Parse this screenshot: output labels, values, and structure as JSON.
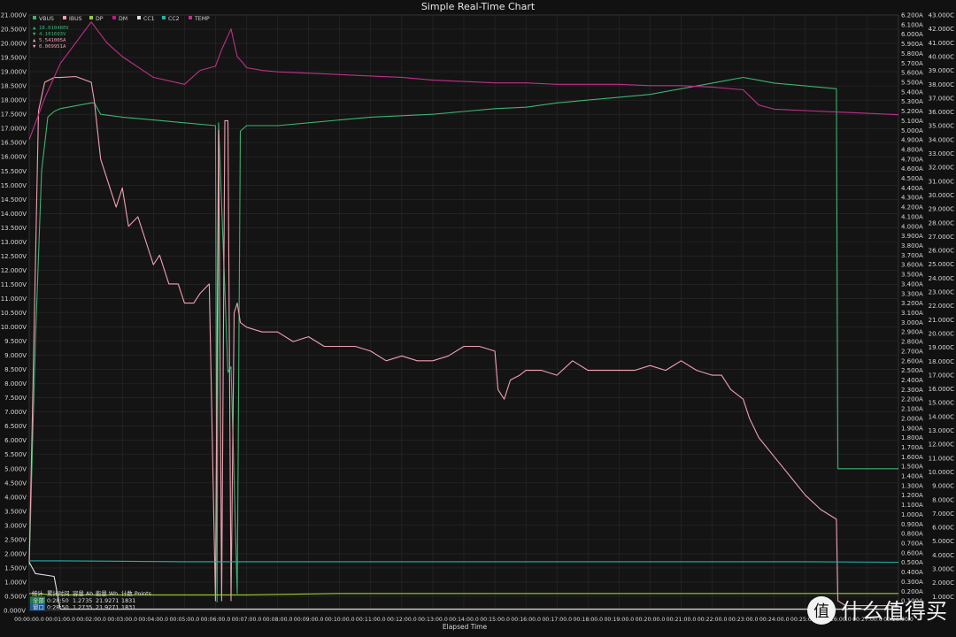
{
  "chart_data": {
    "type": "line",
    "title": "Simple Real-Time Chart",
    "xlabel": "Elapsed Time",
    "x_ticks": [
      "00:00:00.0",
      "00:01:00.0",
      "00:02:00.0",
      "00:03:00.0",
      "00:04:00.0",
      "00:05:00.0",
      "00:06:00.0",
      "00:07:00.0",
      "00:08:00.0",
      "00:09:00.0",
      "00:10:00.0",
      "00:11:00.0",
      "00:12:00.0",
      "00:13:00.0",
      "00:14:00.0",
      "00:15:00.0",
      "00:16:00.0",
      "00:17:00.0",
      "00:18:00.0",
      "00:19:00.0",
      "00:20:00.0",
      "00:21:00.0",
      "00:22:00.0",
      "00:23:00.0",
      "00:24:00.0",
      "00:25:00.0",
      "00:26:00.0",
      "00:27:00.0",
      "00:28:00.0"
    ],
    "x_range_min": [
      0,
      28
    ],
    "y_left": {
      "unit": "V",
      "range": [
        0,
        21
      ],
      "ticks": [
        "0.500V",
        "1.000V",
        "1.500V",
        "2.000V",
        "2.500V",
        "3.000V",
        "3.500V",
        "4.000V",
        "4.500V",
        "5.000V",
        "5.500V",
        "6.000V",
        "6.500V",
        "7.000V",
        "7.500V",
        "8.000V",
        "8.500V",
        "9.000V",
        "9.500V",
        "10.000V",
        "10.500V",
        "11.000V",
        "11.500V",
        "12.000V",
        "12.500V",
        "13.000V",
        "13.500V",
        "14.000V",
        "14.500V",
        "15.000V",
        "15.500V",
        "16.000V",
        "16.500V",
        "17.000V",
        "17.500V",
        "18.000V",
        "18.500V",
        "19.000V",
        "19.500V",
        "20.000V",
        "20.500V",
        "21.000V"
      ]
    },
    "y_right_current": {
      "unit": "A",
      "range": [
        0,
        6.2
      ],
      "ticks": [
        "0.100A",
        "0.200A",
        "0.300A",
        "0.400A",
        "0.500A",
        "0.600A",
        "0.700A",
        "0.800A",
        "0.900A",
        "1.000A",
        "1.100A",
        "1.200A",
        "1.300A",
        "1.400A",
        "1.500A",
        "1.600A",
        "1.700A",
        "1.800A",
        "1.900A",
        "2.000A",
        "2.100A",
        "2.200A",
        "2.300A",
        "2.400A",
        "2.500A",
        "2.600A",
        "2.700A",
        "2.800A",
        "2.900A",
        "3.000A",
        "3.100A",
        "3.200A",
        "3.300A",
        "3.400A",
        "3.500A",
        "3.600A",
        "3.700A",
        "3.800A",
        "3.900A",
        "4.000A",
        "4.100A",
        "4.200A",
        "4.300A",
        "4.400A",
        "4.500A",
        "4.600A",
        "4.700A",
        "4.800A",
        "4.900A",
        "5.000A",
        "5.100A",
        "5.200A",
        "5.300A",
        "5.400A",
        "5.500A",
        "5.600A",
        "5.700A",
        "5.800A",
        "5.900A",
        "6.000A",
        "6.100A",
        "6.200A"
      ]
    },
    "y_right_temp": {
      "unit": "C",
      "range": [
        0,
        43
      ],
      "ticks": [
        "1.000C",
        "2.000C",
        "3.000C",
        "4.000C",
        "5.000C",
        "6.000C",
        "7.000C",
        "8.000C",
        "9.000C",
        "10.000C",
        "11.000C",
        "12.000C",
        "13.000C",
        "14.000C",
        "15.000C",
        "16.000C",
        "17.000C",
        "18.000C",
        "19.000C",
        "20.000C",
        "21.000C",
        "22.000C",
        "23.000C",
        "24.000C",
        "25.000C",
        "26.000C",
        "27.000C",
        "28.000C",
        "29.000C",
        "30.000C",
        "31.000C",
        "32.000C",
        "33.000C",
        "34.000C",
        "35.000C",
        "36.000C",
        "37.000C",
        "38.000C",
        "39.000C",
        "40.000C",
        "41.000C",
        "42.000C",
        "43.000C"
      ]
    },
    "legend": [
      {
        "name": "VBUS",
        "color": "#3cb371"
      },
      {
        "name": "IBUS",
        "color": "#f0a0b0"
      },
      {
        "name": "DP",
        "color": "#9acd32"
      },
      {
        "name": "DM",
        "color": "#c71585"
      },
      {
        "name": "CC1",
        "color": "#e0e0e0"
      },
      {
        "name": "CC2",
        "color": "#20b2aa"
      },
      {
        "name": "TEMP",
        "color": "#c0308a"
      }
    ],
    "legend_placement": "top-left",
    "readouts": [
      {
        "text": "18.010480V",
        "color": "#3cb371"
      },
      {
        "text": "4.101693V",
        "color": "#3cb371"
      },
      {
        "text": "5.541005A",
        "color": "#f0a0b0"
      },
      {
        "text": "0.009951A",
        "color": "#f0a0b0"
      }
    ],
    "series": [
      {
        "name": "VBUS",
        "axis": "V",
        "color": "#3cb371",
        "x": [
          0,
          0.2,
          0.4,
          0.6,
          0.8,
          1,
          1.5,
          2,
          2.1,
          2.3,
          3,
          4,
          5,
          6,
          6.05,
          6.1,
          6.4,
          6.5,
          6.7,
          6.8,
          7,
          8,
          9,
          10,
          11,
          12,
          13,
          14,
          15,
          16,
          17,
          18,
          19,
          20,
          21,
          22,
          22.5,
          23,
          23.5,
          24,
          25,
          26,
          26.05,
          27,
          28
        ],
        "y": [
          1.6,
          9.5,
          15.5,
          17.4,
          17.6,
          17.7,
          17.8,
          17.9,
          17.9,
          17.5,
          17.4,
          17.3,
          17.2,
          17.1,
          0.3,
          17.2,
          8.4,
          8.6,
          0.6,
          16.9,
          17.1,
          17.1,
          17.2,
          17.3,
          17.4,
          17.45,
          17.5,
          17.6,
          17.7,
          17.75,
          17.9,
          18.0,
          18.1,
          18.2,
          18.4,
          18.6,
          18.7,
          18.8,
          18.7,
          18.6,
          18.5,
          18.4,
          5.0,
          5.0,
          5.0
        ]
      },
      {
        "name": "IBUS",
        "axis": "A",
        "color": "#f0a0b0",
        "x": [
          0,
          0.1,
          0.3,
          0.5,
          0.8,
          1,
          1.5,
          2,
          2.1,
          2.3,
          2.6,
          2.8,
          3,
          3.2,
          3.5,
          3.8,
          4,
          4.2,
          4.5,
          4.8,
          5,
          5.3,
          5.5,
          5.8,
          6,
          6.1,
          6.2,
          6.3,
          6.4,
          6.5,
          6.6,
          6.7,
          6.8,
          7,
          7.5,
          8,
          8.5,
          9,
          9.5,
          10,
          10.5,
          11,
          11.5,
          12,
          12.5,
          13,
          13.5,
          14,
          14.5,
          15,
          15.1,
          15.3,
          15.5,
          15.8,
          16,
          16.5,
          17,
          17.5,
          18,
          18.5,
          19,
          19.5,
          20,
          20.5,
          21,
          21.5,
          22,
          22.3,
          22.6,
          23,
          23.2,
          23.5,
          24,
          24.5,
          25,
          25.5,
          26,
          26.05,
          26.3,
          27,
          28
        ],
        "y": [
          0.5,
          2.0,
          5.2,
          5.5,
          5.55,
          5.55,
          5.56,
          5.5,
          5.3,
          4.7,
          4.4,
          4.2,
          4.4,
          4.0,
          4.1,
          3.8,
          3.6,
          3.7,
          3.4,
          3.4,
          3.2,
          3.2,
          3.3,
          3.4,
          0.1,
          5.0,
          0.1,
          5.1,
          5.1,
          0.1,
          3.1,
          3.2,
          3.0,
          2.95,
          2.9,
          2.9,
          2.8,
          2.85,
          2.75,
          2.75,
          2.75,
          2.7,
          2.6,
          2.65,
          2.6,
          2.6,
          2.65,
          2.75,
          2.75,
          2.7,
          2.3,
          2.2,
          2.4,
          2.45,
          2.5,
          2.5,
          2.45,
          2.6,
          2.5,
          2.5,
          2.5,
          2.5,
          2.55,
          2.5,
          2.6,
          2.5,
          2.45,
          2.45,
          2.3,
          2.2,
          2.0,
          1.8,
          1.6,
          1.4,
          1.2,
          1.05,
          0.95,
          0.1,
          0.05,
          0.05,
          0.05
        ]
      },
      {
        "name": "DP",
        "axis": "V",
        "color": "#9acd32",
        "x": [
          0,
          1,
          2,
          5,
          6,
          7,
          10,
          15,
          20,
          25,
          28
        ],
        "y": [
          0.6,
          0.55,
          0.55,
          0.55,
          0.55,
          0.55,
          0.6,
          0.6,
          0.6,
          0.6,
          0.6
        ]
      },
      {
        "name": "CC1",
        "axis": "V",
        "color": "#e0e0e0",
        "x": [
          0,
          0.2,
          0.8,
          1,
          6,
          7,
          15,
          20,
          25,
          28
        ],
        "y": [
          1.7,
          1.3,
          1.2,
          0.05,
          0.05,
          0.05,
          0.05,
          0.05,
          0.05,
          0.05
        ]
      },
      {
        "name": "CC2",
        "axis": "V",
        "color": "#20b2aa",
        "x": [
          0,
          1,
          5,
          10,
          15,
          20,
          25,
          28
        ],
        "y": [
          1.75,
          1.75,
          1.72,
          1.72,
          1.72,
          1.72,
          1.72,
          1.7
        ]
      },
      {
        "name": "TEMP",
        "axis": "C",
        "color": "#c0308a",
        "x": [
          0,
          0.5,
          1,
          1.5,
          2,
          2.5,
          3,
          4,
          5,
          5.5,
          6,
          6.2,
          6.5,
          6.7,
          6.9,
          7,
          7.5,
          8,
          9,
          10,
          11,
          12,
          13,
          14,
          15,
          16,
          17,
          18,
          19,
          20,
          21,
          22,
          22.5,
          23,
          23.5,
          24,
          25,
          26,
          27,
          28
        ],
        "y": [
          34.0,
          37.0,
          39.5,
          41.0,
          42.5,
          41.0,
          40.0,
          38.5,
          38.0,
          39.0,
          39.3,
          40.5,
          42.0,
          40.0,
          39.5,
          39.2,
          39.0,
          38.9,
          38.8,
          38.7,
          38.6,
          38.5,
          38.3,
          38.2,
          38.1,
          38.1,
          38.0,
          38.0,
          38.0,
          37.9,
          37.9,
          37.8,
          37.7,
          37.6,
          36.5,
          36.2,
          36.1,
          36.0,
          35.9,
          35.8
        ]
      }
    ],
    "grid": true
  },
  "stats_table": {
    "header": [
      "统计",
      "累计时间",
      "容量 Ah",
      "能量 Wh",
      "计数 Points"
    ],
    "rows": [
      [
        "全部",
        "0:28:50",
        "1.2735",
        "21.9271",
        "1831"
      ],
      [
        "窗口",
        "0:28:50",
        "1.2735",
        "21.9271",
        "1831"
      ]
    ]
  },
  "watermark": "什么值得买"
}
